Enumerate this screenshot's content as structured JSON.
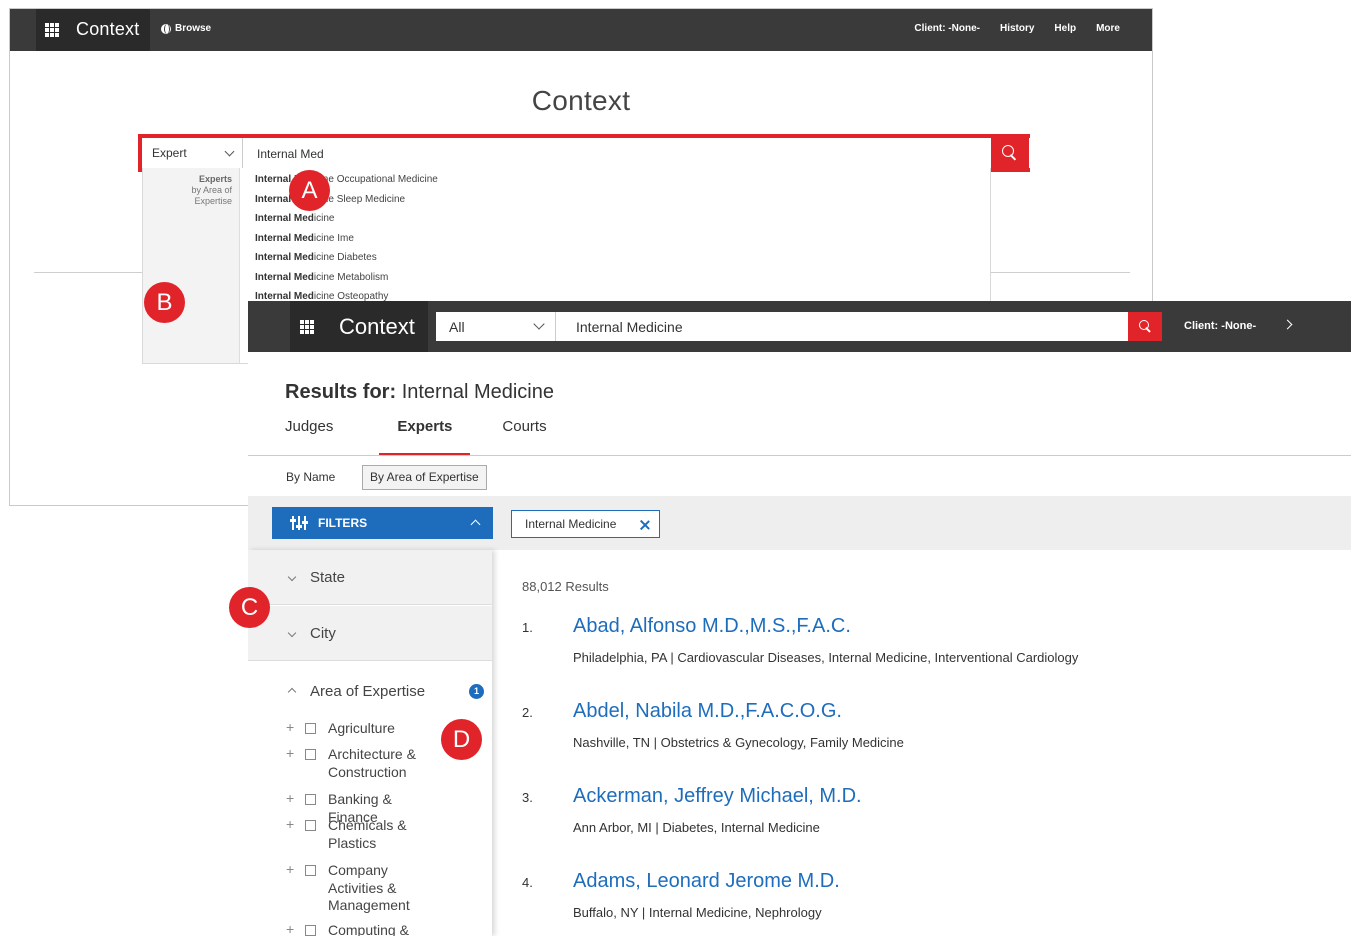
{
  "back_window": {
    "app_name": "Context",
    "browse_label": "Browse",
    "top_right": [
      "Client: -None-",
      "History",
      "Help",
      "More"
    ],
    "page_title": "Context",
    "search_type": "Expert",
    "search_value": "Internal Med",
    "dropdown": {
      "group_label": "Experts",
      "group_sub_1": "by Area of",
      "group_sub_2": "Expertise",
      "items": [
        {
          "bold": "Internal",
          "rest": " Medicine Occupational Medicine"
        },
        {
          "bold": "Internal",
          "rest": " Medicine Sleep Medicine"
        },
        {
          "bold": "Internal Med",
          "rest": "icine"
        },
        {
          "bold": "Internal Med",
          "rest": "icine Ime"
        },
        {
          "bold": "Internal Med",
          "rest": "icine Diabetes"
        },
        {
          "bold": "Internal Med",
          "rest": "icine Metabolism"
        },
        {
          "bold": "Internal Med",
          "rest": "icine Osteopathy"
        }
      ]
    }
  },
  "front_window": {
    "app_name": "Context",
    "scope": "All",
    "search_value": "Internal Medicine",
    "client_label": "Client: -None-",
    "results_label": "Results for:",
    "results_query": "Internal Medicine",
    "tabs": [
      "Judges",
      "Experts",
      "Courts"
    ],
    "active_tab": "Experts",
    "sub_tabs": [
      "By Name",
      "By Area of Expertise"
    ],
    "filters_label": "FILTERS",
    "filter_chip": "Internal Medicine",
    "filter_sections": [
      "State",
      "City"
    ],
    "expertise": {
      "label": "Area of Expertise",
      "badge": "1",
      "options": [
        "Agriculture",
        "Architecture & Construction",
        "Banking & Finance",
        "Chemicals & Plastics",
        "Company Activities & Management",
        "Computing &"
      ]
    },
    "results_count": "88,012 Results",
    "results": [
      {
        "num": "1.",
        "name": "Abad, Alfonso M.D.,M.S.,F.A.C.",
        "meta": "Philadelphia, PA  |  Cardiovascular Diseases, Internal Medicine, Interventional Cardiology"
      },
      {
        "num": "2.",
        "name": "Abdel, Nabila M.D.,F.A.C.O.G.",
        "meta": "Nashville, TN  |  Obstetrics & Gynecology, Family Medicine"
      },
      {
        "num": "3.",
        "name": "Ackerman, Jeffrey Michael, M.D.",
        "meta": "Ann Arbor, MI  |  Diabetes, Internal Medicine"
      },
      {
        "num": "4.",
        "name": "Adams, Leonard Jerome M.D.",
        "meta": "Buffalo, NY  |  Internal Medicine, Nephrology"
      }
    ]
  },
  "callouts": [
    "A",
    "B",
    "C",
    "D"
  ],
  "colors": {
    "accent_red": "#e0242a",
    "link_blue": "#1e6dbd",
    "topbar": "#3a3a3a"
  }
}
